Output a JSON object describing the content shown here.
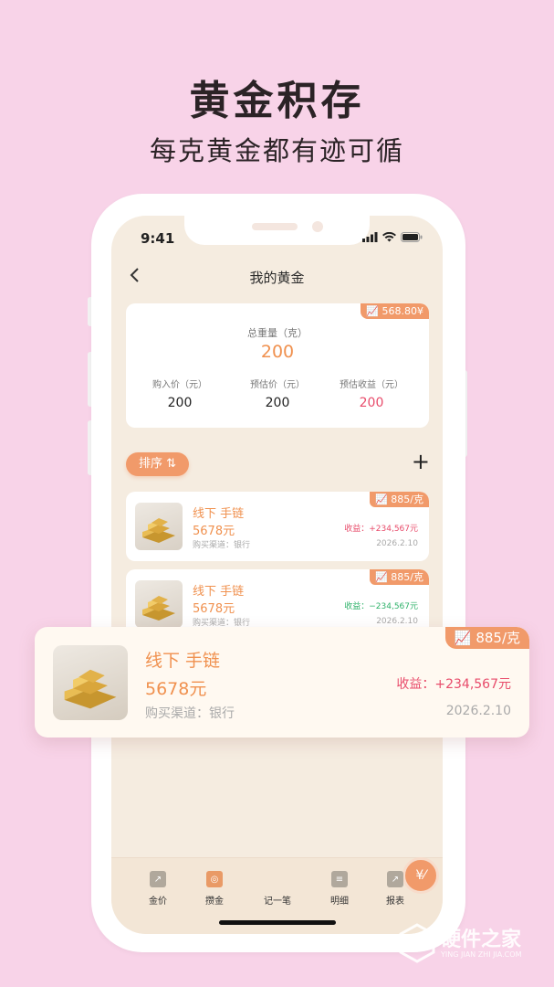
{
  "promo": {
    "headline": "黄金积存",
    "subline": "每克黄金都有迹可循"
  },
  "status_bar": {
    "time": "9:41"
  },
  "nav": {
    "title": "我的黄金",
    "back_icon": "chevron-left-icon"
  },
  "summary": {
    "price_tag": "568.80¥",
    "total_weight_label": "总重量（克）",
    "total_weight_value": "200",
    "stats": [
      {
        "label": "购入价（元）",
        "value": "200"
      },
      {
        "label": "预估价（元）",
        "value": "200"
      },
      {
        "label": "预估收益（元）",
        "value": "200"
      }
    ]
  },
  "toolbar": {
    "sort_label": "排序 ⇅",
    "add_label": "+"
  },
  "items": [
    {
      "price_tag": "885/克",
      "title": "线下  手链",
      "price": "5678元",
      "channel": "购买渠道：银行",
      "profit": "收益：+234,567元",
      "date": "2026.2.10"
    },
    {
      "price_tag": "885/克",
      "title": "线下  手链",
      "price": "5678元",
      "channel": "购买渠道：银行",
      "profit": "收益：−234,567元",
      "date": "2026.2.10"
    }
  ],
  "highlight_item": {
    "price_tag": "885/克",
    "title": "线下  手链",
    "price": "5678元",
    "channel": "购买渠道：银行",
    "profit": "收益：+234,567元",
    "date": "2026.2.10"
  },
  "tabs": [
    {
      "label": "金价",
      "icon": "chart-icon"
    },
    {
      "label": "攒金",
      "icon": "savings-icon"
    },
    {
      "label": "记一笔",
      "icon": "yen-pen-icon"
    },
    {
      "label": "明细",
      "icon": "list-icon"
    },
    {
      "label": "报表",
      "icon": "report-icon"
    }
  ],
  "watermark": {
    "text": "硬件之家",
    "sub": "YING JIAN ZHI JIA.COM"
  },
  "colors": {
    "background": "#f8d3e8",
    "accent": "#f19a6a",
    "gain": "#e84c6b",
    "loss": "#2fb26a"
  }
}
